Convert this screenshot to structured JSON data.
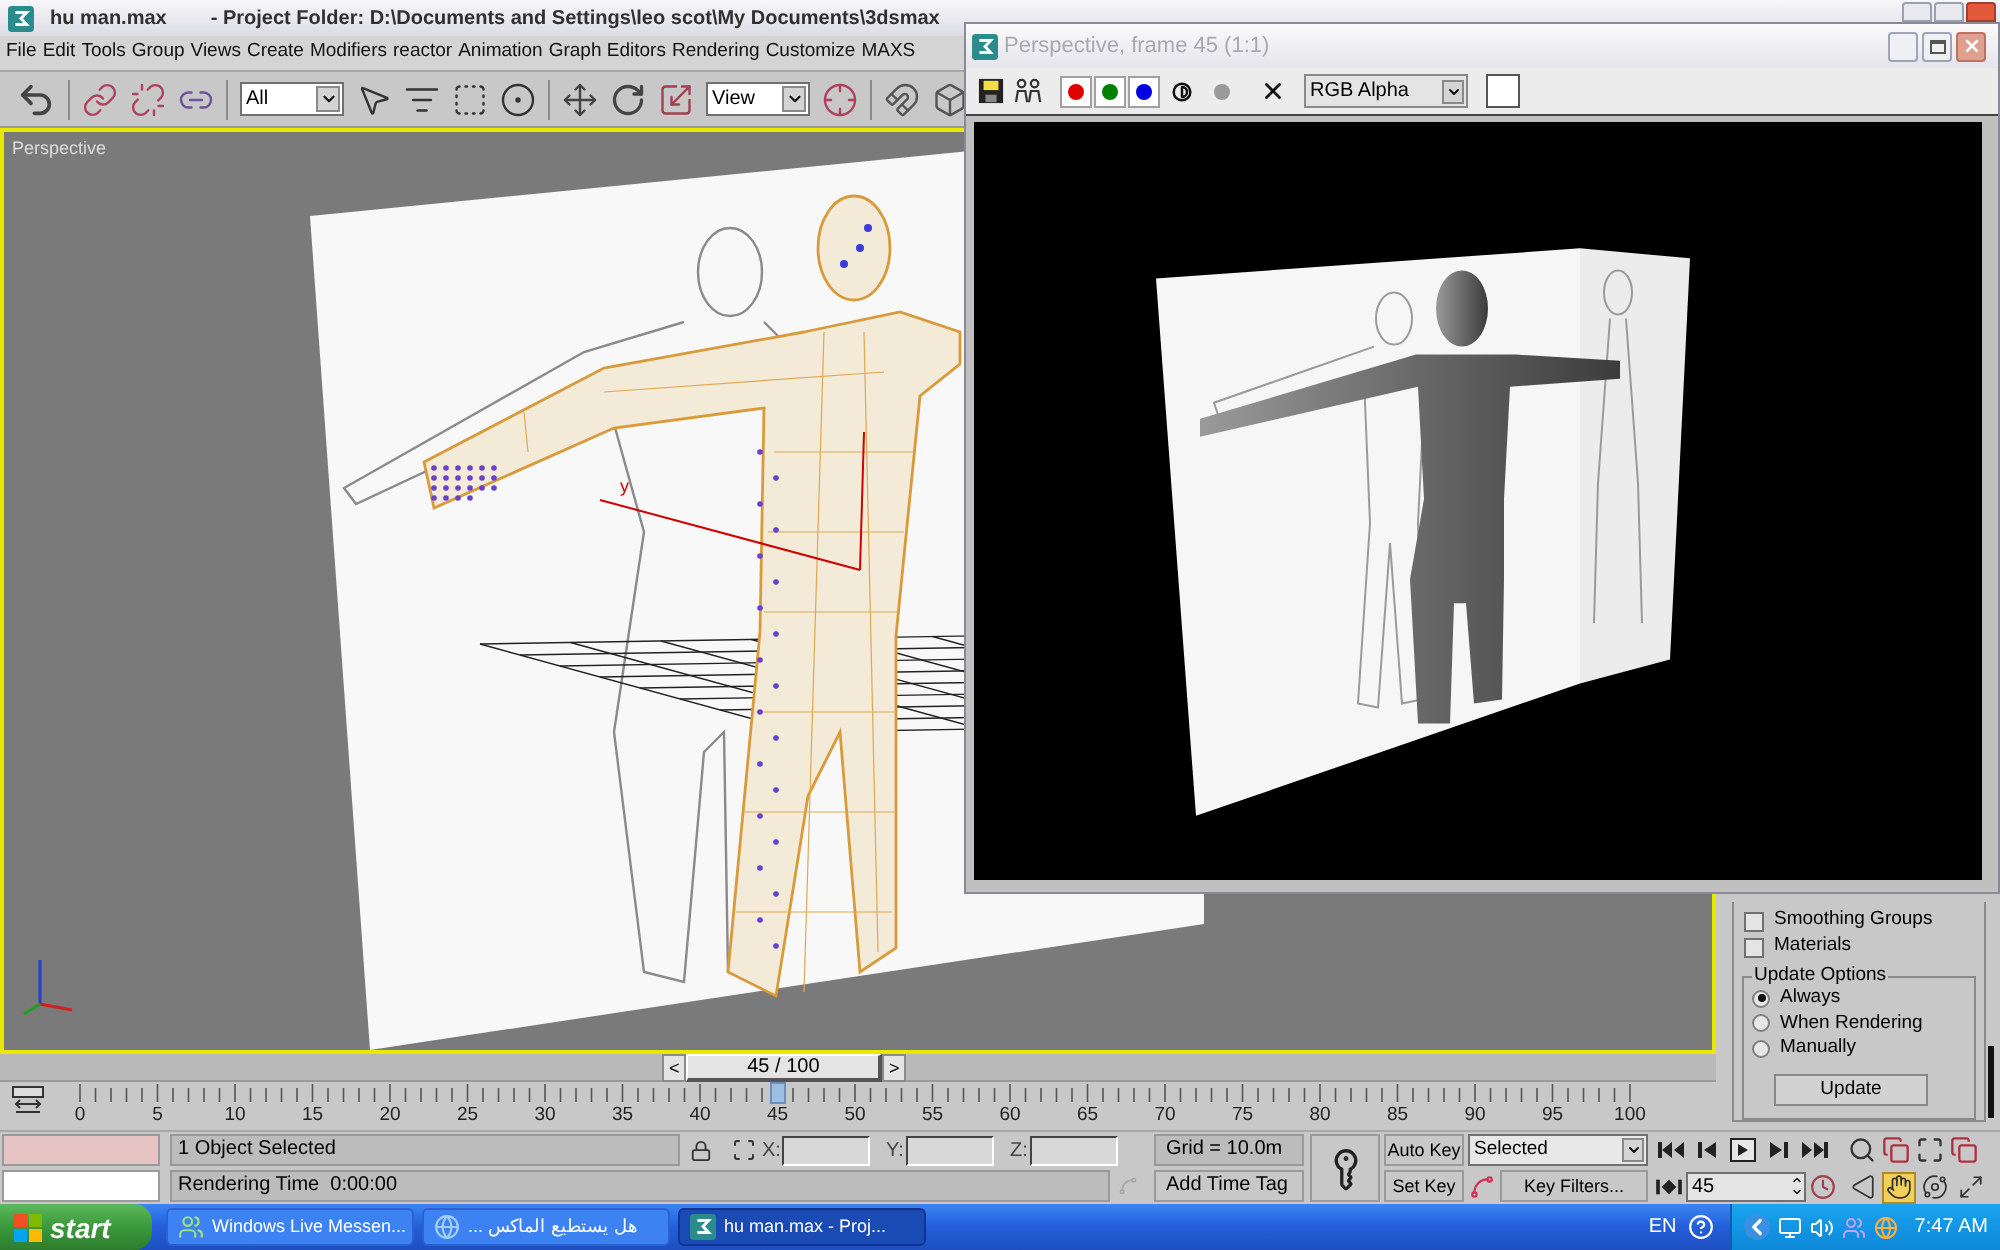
{
  "main_window": {
    "title": "hu man.max",
    "project_folder": "- Project Folder: D:\\Documents and Settings\\leo scot\\My Documents\\3dsmax"
  },
  "menu": [
    "File",
    "Edit",
    "Tools",
    "Group",
    "Views",
    "Create",
    "Modifiers",
    "reactor",
    "Animation",
    "Graph Editors",
    "Rendering",
    "Customize",
    "MAXS"
  ],
  "toolbar": {
    "selection_filter": "All",
    "reference_coordinate_system": "View"
  },
  "viewport": {
    "label": "Perspective",
    "active": true,
    "gizmo_axis": "y"
  },
  "render_window": {
    "title": "Perspective, frame 45 (1:1)",
    "channels": [
      {
        "color": "#e00000",
        "on": true
      },
      {
        "color": "#008000",
        "on": true
      },
      {
        "color": "#0000e0",
        "on": true
      }
    ],
    "channel_display": "RGB Alpha"
  },
  "command_panel": {
    "checkboxes": [
      {
        "label": "Smoothing Groups",
        "checked": false
      },
      {
        "label": "Materials",
        "checked": false
      }
    ],
    "update_options": {
      "title": "Update Options",
      "options": [
        {
          "label": "Always",
          "selected": true
        },
        {
          "label": "When Rendering",
          "selected": false
        },
        {
          "label": "Manually",
          "selected": false
        }
      ],
      "button": "Update"
    }
  },
  "time_slider": {
    "previous": "<",
    "position": "45 / 100",
    "next": ">",
    "level": 0.45
  },
  "track_bar": {
    "ticks": [
      "0",
      "5",
      "10",
      "15",
      "20",
      "25",
      "30",
      "35",
      "40",
      "45",
      "50",
      "55",
      "60",
      "65",
      "70",
      "75",
      "80",
      "85",
      "90",
      "95",
      "100"
    ]
  },
  "status_bar": {
    "prompt": "1 Object Selected",
    "info": "Rendering Time  0:00:00",
    "coordinates": [
      "X:",
      "Y:",
      "Z:"
    ],
    "grid": "Grid = 10.0m",
    "time_tag": "Add Time Tag"
  },
  "animation_controls": {
    "auto_key": "Auto Key",
    "key_set": "Selected",
    "set_key": "Set Key",
    "key_filters": "Key Filters...",
    "current_frame": "45"
  },
  "navigation": {
    "tools": [
      {
        "kind": "fov",
        "active": false
      },
      {
        "kind": "pan",
        "active": true
      },
      {
        "kind": "orbit",
        "active": false
      },
      {
        "kind": "maximize",
        "active": false
      }
    ]
  },
  "taskbar": {
    "start": "start",
    "tasks": [
      {
        "kind": "messenger",
        "label": "Windows Live Messen...",
        "selected": false
      },
      {
        "kind": "browser",
        "label": "هل يستطيع الماكس ...",
        "selected": false
      },
      {
        "kind": "max",
        "label": "hu man.max - Proj...",
        "selected": true
      }
    ],
    "language": "EN",
    "clock": "7:47 AM"
  }
}
